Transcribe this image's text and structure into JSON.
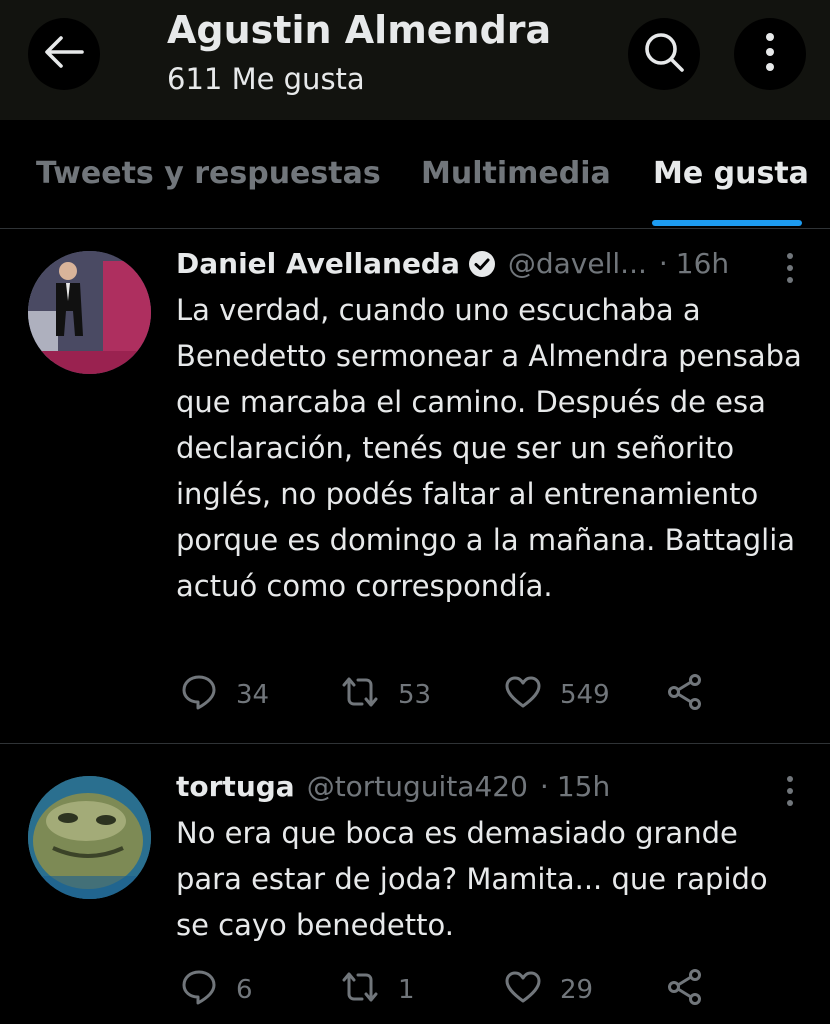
{
  "header": {
    "title": "Agustin Almendra",
    "subtitle": "611 Me gusta",
    "icons": {
      "back": "arrow-left-icon",
      "search": "search-icon",
      "more": "more-vertical-icon"
    }
  },
  "tabs": [
    {
      "label": "Tweets y respuestas",
      "active": false
    },
    {
      "label": "Multimedia",
      "active": false
    },
    {
      "label": "Me gusta",
      "active": true
    }
  ],
  "colors": {
    "accent": "#1d9bf0",
    "muted": "#71767b",
    "background": "#000000",
    "header_bg": "#12130f"
  },
  "tweets": [
    {
      "name": "Daniel Avellaneda",
      "verified": true,
      "handle": "@davell...",
      "separator": "·",
      "time": "16h",
      "text": "La verdad, cuando uno escuchaba a Benedetto sermonear a Almendra pensaba que marcaba el camino. Después de esa declaración, tenés que ser un señorito inglés, no podés faltar al entrenamiento porque es domingo a la mañana. Battaglia actuó como correspondía.",
      "replies": "34",
      "retweets": "53",
      "likes": "549"
    },
    {
      "name": "tortuga",
      "verified": false,
      "handle": "@tortuguita420",
      "separator": "·",
      "time": "15h",
      "text": "No era que boca es demasiado grande para estar de joda? Mamita... que rapido se cayo benedetto.",
      "replies": "6",
      "retweets": "1",
      "likes": "29"
    }
  ]
}
